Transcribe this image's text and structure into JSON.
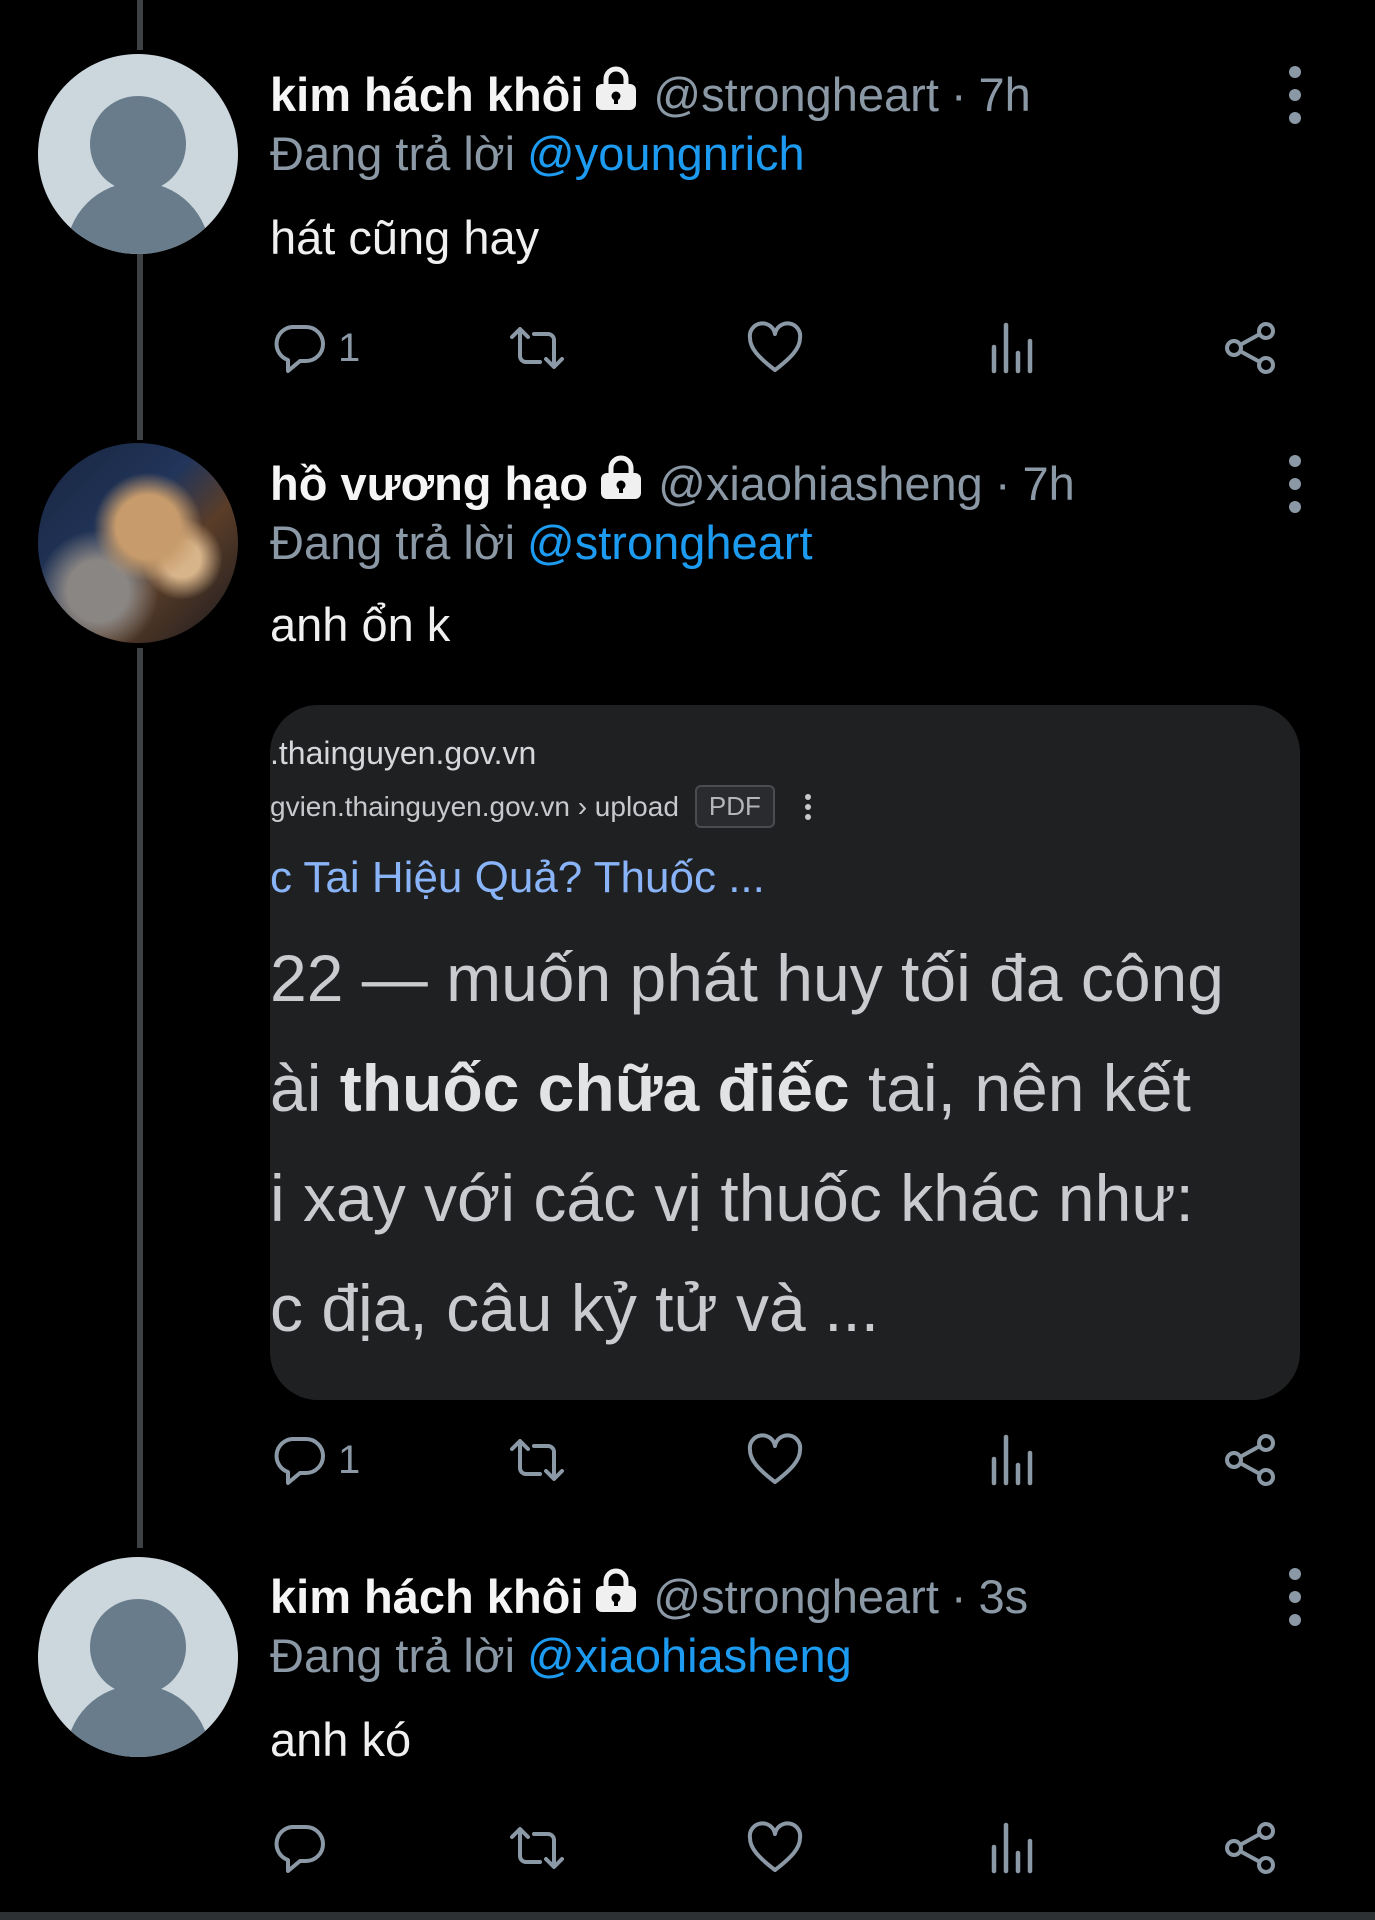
{
  "colors": {
    "background": "#000000",
    "accent": "#1d9bf0",
    "muted": "#8b98a5",
    "line": "#3e4144"
  },
  "tweets": [
    {
      "name": "kim hách khôi",
      "handle": "@strongheart",
      "dot": "·",
      "time": "7h",
      "reply_prefix": "Đang trả lời",
      "reply_to": "@youngnrich",
      "text": "hát cũng hay",
      "reply_count": "1"
    },
    {
      "name": "hồ vương hạo",
      "handle": "@xiaohiasheng",
      "dot": "·",
      "time": "7h",
      "reply_prefix": "Đang trả lời",
      "reply_to": "@strongheart",
      "text": "anh ổn k",
      "reply_count": "1",
      "card": {
        "site": ".thainguyen.gov.vn",
        "breadcrumb": "gvien.thainguyen.gov.vn › upload",
        "badge": "PDF",
        "title": "́c Tai Hiệu Quả? Thuốc ...",
        "snippet_1": "22 — muốn phát huy tối đa công",
        "snippet_2a": "ài ",
        "snippet_2b": "thuốc chữa điếc",
        "snippet_2c": " tai, nên kết",
        "snippet_3": "́i xay với các vị thuốc khác như:",
        "snippet_4": "c địa, câu kỷ tử và ..."
      }
    },
    {
      "name": "kim hách khôi",
      "handle": "@strongheart",
      "dot": "·",
      "time": "3s",
      "reply_prefix": "Đang trả lời",
      "reply_to": "@xiaohiasheng",
      "text": "anh kó",
      "reply_count": ""
    }
  ],
  "icons": {
    "reply": "comment-icon",
    "retweet": "retweet-icon",
    "like": "heart-icon",
    "views": "analytics-icon",
    "share": "share-icon",
    "lock": "lock-icon",
    "more": "more-options-icon"
  }
}
